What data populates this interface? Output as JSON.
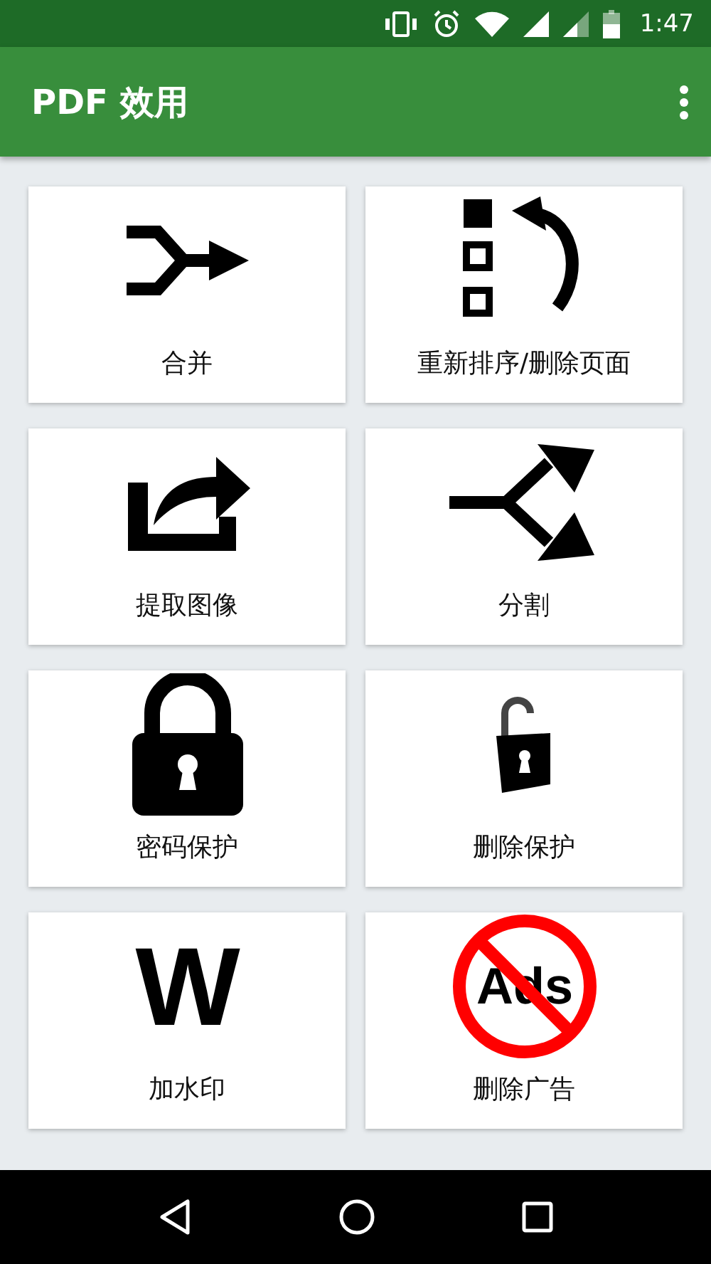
{
  "status_bar": {
    "time": "1:47"
  },
  "app_bar": {
    "title": "PDF 效用"
  },
  "tiles": [
    {
      "label": "合并",
      "kind": "merge"
    },
    {
      "label": "重新排序/删除页面",
      "kind": "reorder"
    },
    {
      "label": "提取图像",
      "kind": "extract"
    },
    {
      "label": "分割",
      "kind": "split"
    },
    {
      "label": "密码保护",
      "kind": "lock"
    },
    {
      "label": "删除保护",
      "kind": "unlock"
    },
    {
      "label": "加水印",
      "kind": "watermark",
      "icon_text": "W"
    },
    {
      "label": "删除广告",
      "kind": "no_ads",
      "icon_text": "Ads"
    }
  ]
}
